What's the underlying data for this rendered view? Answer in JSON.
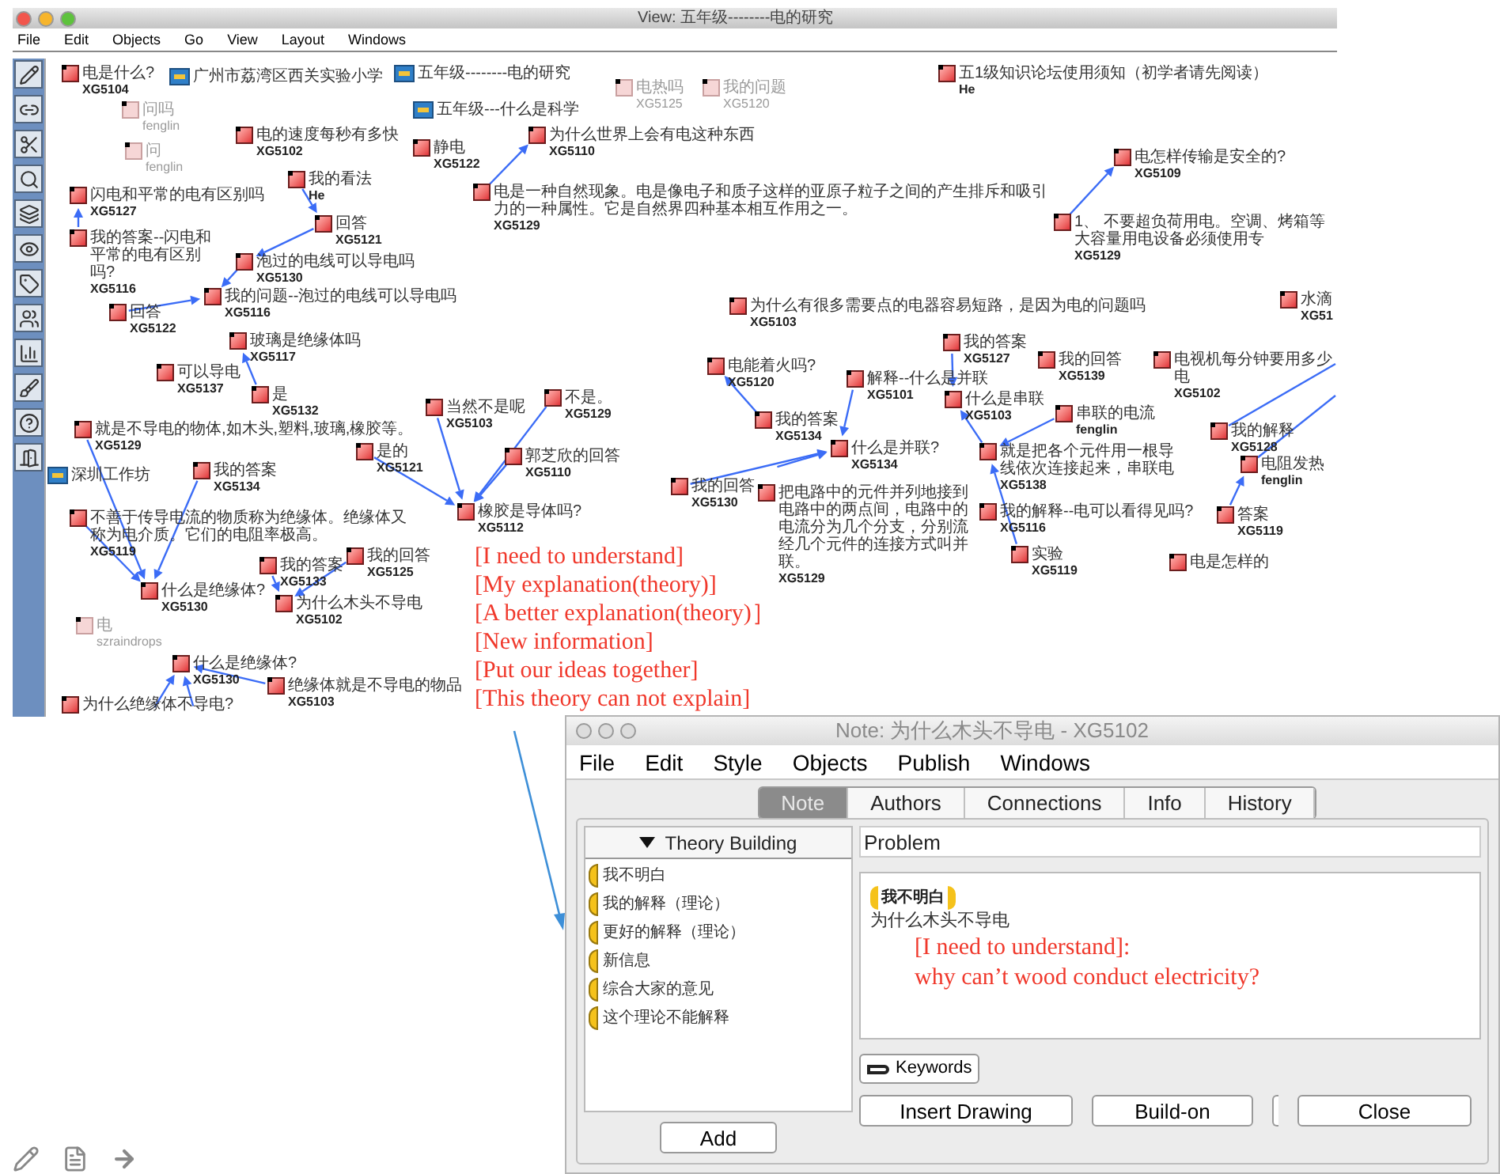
{
  "view_window": {
    "title": "View: 五年级--------电的研究",
    "menu": [
      "File",
      "Edit",
      "Objects",
      "Go",
      "View",
      "Layout",
      "Windows"
    ],
    "notes": [
      {
        "kind": "note",
        "title": "电是什么?",
        "author": "XG5104",
        "read": false
      },
      {
        "kind": "view",
        "title": "广州市荔湾区西关实验小学",
        "read": false
      },
      {
        "kind": "view",
        "title": "五年级--------电的研究",
        "read": false
      },
      {
        "kind": "note",
        "title": "电热吗",
        "author": "XG5125",
        "read": true
      },
      {
        "kind": "note",
        "title": "我的问题",
        "author": "XG5120",
        "read": true
      },
      {
        "kind": "note",
        "title": "五1级知识论坛使用须知（初学者请先阅读）",
        "author": "He",
        "read": false
      },
      {
        "kind": "note",
        "title": "问吗",
        "author": "fenglin",
        "read": true
      },
      {
        "kind": "view",
        "title": "五年级---什么是科学",
        "read": false
      },
      {
        "kind": "note",
        "title": "电的速度每秒有多快",
        "author": "XG5102",
        "read": false
      },
      {
        "kind": "note",
        "title": "问",
        "author": "fenglin",
        "read": true
      },
      {
        "kind": "note",
        "title": "静电",
        "author": "XG5122",
        "read": false
      },
      {
        "kind": "note",
        "title": "为什么世界上会有电这种东西",
        "author": "XG5110",
        "read": false
      },
      {
        "kind": "note",
        "title": "电怎样传输是安全的?",
        "author": "XG5109",
        "read": false
      },
      {
        "kind": "note",
        "title": "我的看法",
        "author": "He",
        "read": false
      },
      {
        "kind": "note",
        "title": "闪电和平常的电有区别吗",
        "author": "XG5127",
        "read": false
      },
      {
        "kind": "note",
        "title": "电是一种自然现象。电是像电子和质子这样的亚原子粒子之间的产生排斥和吸引力的一种属性。它是自然界四种基本相互作用之一。",
        "author": "XG5129",
        "read": false
      },
      {
        "kind": "note",
        "title": "我的答案--闪电和平常的电有区别吗?",
        "author": "XG5116",
        "read": false
      },
      {
        "kind": "note",
        "title": "回答",
        "author": "XG5121",
        "read": false
      },
      {
        "kind": "note",
        "title": "泡过的电线可以导电吗",
        "author": "XG5130",
        "read": false
      },
      {
        "kind": "note",
        "title": "1、 不要超负荷用电。空调、烤箱等大容量用电设备必须使用专",
        "author": "XG5129",
        "read": false
      },
      {
        "kind": "note",
        "title": "回答",
        "author": "XG5122",
        "read": false
      },
      {
        "kind": "note",
        "title": "我的问题--泡过的电线可以导电吗",
        "author": "XG5116",
        "read": false
      },
      {
        "kind": "note",
        "title": "为什么有很多需要点的电器容易短路，是因为电的问题吗",
        "author": "XG5103",
        "read": false
      },
      {
        "kind": "note",
        "title": "水滴",
        "author": "XG51",
        "read": false
      },
      {
        "kind": "note",
        "title": "玻璃是绝缘体吗",
        "author": "XG5117",
        "read": false
      },
      {
        "kind": "note",
        "title": "我的答案",
        "author": "XG5127",
        "read": false
      },
      {
        "kind": "note",
        "title": "可以导电",
        "author": "XG5137",
        "read": false
      },
      {
        "kind": "note",
        "title": "电能着火吗?",
        "author": "XG5120",
        "read": false
      },
      {
        "kind": "note",
        "title": "解释--什么是并联",
        "author": "XG5101",
        "read": false
      },
      {
        "kind": "note",
        "title": "我的回答",
        "author": "XG5139",
        "read": false
      },
      {
        "kind": "note",
        "title": "电视机每分钟要用多少电",
        "author": "XG5102",
        "read": false
      },
      {
        "kind": "note",
        "title": "是",
        "author": "XG5132",
        "read": false
      },
      {
        "kind": "note",
        "title": "当然不是呢",
        "author": "XG5103",
        "read": false
      },
      {
        "kind": "note",
        "title": "不是。",
        "author": "XG5129",
        "read": false
      },
      {
        "kind": "note",
        "title": "什么是串联",
        "author": "XG5103",
        "read": false
      },
      {
        "kind": "note",
        "title": "就是不导电的物体,如木头,塑料,玻璃,橡胶等。",
        "author": "XG5129",
        "read": false
      },
      {
        "kind": "note",
        "title": "我的答案",
        "author": "XG5134",
        "read": false
      },
      {
        "kind": "note",
        "title": "串联的电流",
        "author": "fenglin",
        "read": false
      },
      {
        "kind": "view",
        "title": "深圳工作坊",
        "read": false
      },
      {
        "kind": "note",
        "title": "我的答案",
        "author": "XG5134",
        "read": false
      },
      {
        "kind": "note",
        "title": "是的",
        "author": "XG5121",
        "read": false
      },
      {
        "kind": "note",
        "title": "郭芝欣的回答",
        "author": "XG5110",
        "read": false
      },
      {
        "kind": "note",
        "title": "什么是并联?",
        "author": "XG5134",
        "read": false
      },
      {
        "kind": "note",
        "title": "就是把各个元件用一根导线依次连接起来，串联电",
        "author": "XG5138",
        "read": false
      },
      {
        "kind": "note",
        "title": "我的解释",
        "author": "XG5128",
        "read": false
      },
      {
        "kind": "note",
        "title": "电阻发热",
        "author": "fenglin",
        "read": false
      },
      {
        "kind": "note",
        "title": "不善于传导电流的物质称为绝缘体。绝缘体又称为电介质。它们的电阻率极高。",
        "author": "XG5119",
        "read": false
      },
      {
        "kind": "note",
        "title": "橡胶是导体吗?",
        "author": "XG5112",
        "read": false
      },
      {
        "kind": "note",
        "title": "我的回答",
        "author": "XG5130",
        "read": false
      },
      {
        "kind": "note",
        "title": "我的答案",
        "author": "XG5133",
        "read": false
      },
      {
        "kind": "note",
        "title": "我的回答",
        "author": "XG5125",
        "read": false
      },
      {
        "kind": "note",
        "title": "把电路中的元件并列地接到电路中的两点间，电路中的电流分为几个分支，分别流经几个元件的连接方式叫并联。",
        "author": "XG5129",
        "read": false
      },
      {
        "kind": "note",
        "title": "我的解释--电可以看得见吗?",
        "author": "XG5116",
        "read": false
      },
      {
        "kind": "note",
        "title": "答案",
        "author": "XG5119",
        "read": false
      },
      {
        "kind": "note",
        "title": "实验",
        "author": "XG5119",
        "read": false
      },
      {
        "kind": "note",
        "title": "电是怎样的",
        "read": false
      },
      {
        "kind": "note",
        "title": "什么是绝缘体?",
        "author": "XG5130",
        "read": false
      },
      {
        "kind": "note",
        "title": "为什么木头不导电",
        "author": "XG5102",
        "read": false
      },
      {
        "kind": "note",
        "title": "电",
        "author": "szraindrops",
        "read": true
      },
      {
        "kind": "note",
        "title": "什么是绝缘体?",
        "author": "XG5130",
        "read": false
      },
      {
        "kind": "note",
        "title": "为什么绝缘体不导电?",
        "read": false
      },
      {
        "kind": "note",
        "title": "绝缘体就是不导电的物品",
        "author": "XG5103",
        "read": false
      }
    ]
  },
  "annotation": [
    "[I need to understand]",
    "[My explanation(theory)]",
    "[A better explanation(theory)］",
    "[New information]",
    "[Put our ideas together]",
    "[This theory can not explain]"
  ],
  "note_window": {
    "title": "Note: 为什么木头不导电 - XG5102",
    "menu": [
      "File",
      "Edit",
      "Style",
      "Objects",
      "Publish",
      "Windows"
    ],
    "tabs": [
      {
        "label": "Note",
        "selected": true
      },
      {
        "label": "Authors",
        "selected": false
      },
      {
        "label": "Connections",
        "selected": false
      },
      {
        "label": "Info",
        "selected": false
      },
      {
        "label": "History",
        "selected": false
      }
    ],
    "scaffold_header": "Theory Building",
    "scaffolds": [
      "我不明白",
      "我的解释（理论）",
      "更好的解释（理论）",
      "新信息",
      "综合大家的意见",
      "这个理论不能解释"
    ],
    "add_button": "Add",
    "problem_label": "Problem",
    "scaffold_tag": "我不明白",
    "body": "为什么木头不导电",
    "body_annotation": [
      "[I need to understand]:",
      "why can’t wood conduct electricity?"
    ],
    "keywords_button": "Keywords",
    "buttons": [
      "Insert Drawing",
      "Build-on",
      "Close"
    ]
  }
}
